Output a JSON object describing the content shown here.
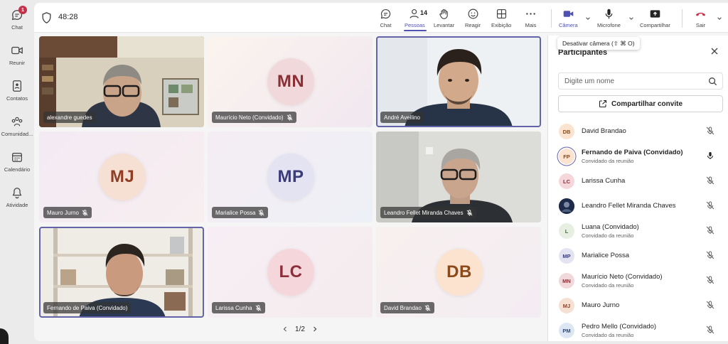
{
  "rail": {
    "items": [
      {
        "label": "Chat",
        "icon": "chat-icon",
        "badge": "1"
      },
      {
        "label": "Reunir",
        "icon": "video-icon"
      },
      {
        "label": "Contatos",
        "icon": "contacts-icon"
      },
      {
        "label": "Comunidad...",
        "icon": "community-icon"
      },
      {
        "label": "Calendário",
        "icon": "calendar-icon"
      },
      {
        "label": "Atividade",
        "icon": "bell-icon"
      }
    ]
  },
  "meeting": {
    "timer": "48:28",
    "toolbar": {
      "chat": "Chat",
      "people": "Pessoas",
      "people_count": "14",
      "raise": "Levantar",
      "react": "Reagir",
      "view": "Exibição",
      "more": "Mais",
      "camera": "Câmera",
      "mic": "Microfone",
      "share": "Compartilhar",
      "leave": "Sair"
    },
    "tooltip": "Desativar câmera (⇧ ⌘ O)",
    "pager": "1/2"
  },
  "tiles": [
    {
      "name": "alexandre guedes",
      "type": "video"
    },
    {
      "name": "Maurício Neto (Convidado)",
      "initials": "MN",
      "muted": true
    },
    {
      "name": "André Avellino",
      "type": "video"
    },
    {
      "name": "Mauro Jurno",
      "initials": "MJ",
      "muted": true
    },
    {
      "name": "Marialice Possa",
      "initials": "MP",
      "muted": true
    },
    {
      "name": "Leandro Fellet Miranda Chaves",
      "type": "video",
      "muted": true
    },
    {
      "name": "Fernando de Paiva (Convidado)",
      "type": "video"
    },
    {
      "name": "Larissa Cunha",
      "initials": "LC",
      "muted": true
    },
    {
      "name": "David Brandao",
      "initials": "DB",
      "muted": true
    }
  ],
  "panel": {
    "title": "Participantes",
    "search_placeholder": "Digite um nome",
    "share_label": "Compartilhar convite",
    "participants": [
      {
        "initials": "DB",
        "name": "David Brandao",
        "sub": "",
        "mic": "muted"
      },
      {
        "initials": "FP",
        "name": "Fernando de Paiva (Convidado)",
        "sub": "Convidado da reunião",
        "mic": "speaking"
      },
      {
        "initials": "LC",
        "name": "Larissa Cunha",
        "sub": "",
        "mic": "muted"
      },
      {
        "initials": "",
        "name": "Leandro Fellet Miranda Chaves",
        "sub": "",
        "mic": "muted"
      },
      {
        "initials": "L",
        "name": "Luana (Convidado)",
        "sub": "Convidado da reunião",
        "mic": "muted"
      },
      {
        "initials": "MP",
        "name": "Marialice Possa",
        "sub": "",
        "mic": "muted"
      },
      {
        "initials": "MN",
        "name": "Maurício Neto (Convidado)",
        "sub": "Convidado da reunião",
        "mic": "muted"
      },
      {
        "initials": "MJ",
        "name": "Mauro Jurno",
        "sub": "",
        "mic": "muted"
      },
      {
        "initials": "PM",
        "name": "Pedro Mello (Convidado)",
        "sub": "Convidado da reunião",
        "mic": "muted"
      }
    ]
  },
  "colors": {
    "accent": "#4f52b2",
    "leave": "#c4314b",
    "tile_bg": "#f6eef0"
  }
}
